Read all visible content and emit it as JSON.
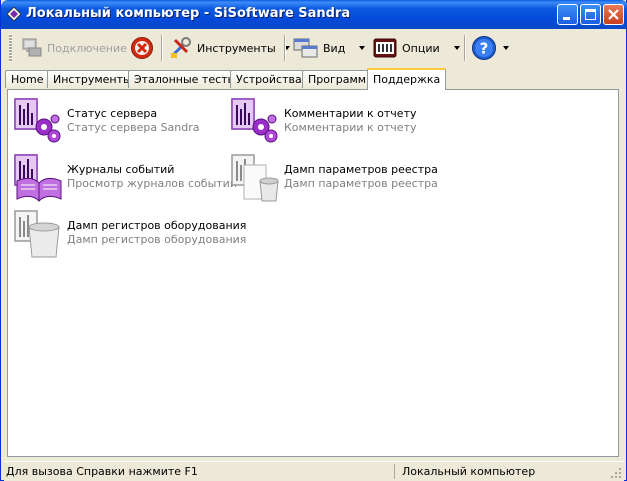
{
  "window": {
    "title": "Локальный компьютер - SiSoftware Sandra"
  },
  "toolbar": {
    "connect_label": "Подключение",
    "tools_label": "Инструменты",
    "view_label": "Вид",
    "options_label": "Опции"
  },
  "tabs": [
    {
      "label": "Home"
    },
    {
      "label": "Инструменты"
    },
    {
      "label": "Эталонные тесты"
    },
    {
      "label": "Устройства"
    },
    {
      "label": "Программы"
    },
    {
      "label": "Поддержка"
    }
  ],
  "items": [
    {
      "name": "Статус сервера",
      "desc": "Статус сервера Sandra",
      "icon": "server-status-icon"
    },
    {
      "name": "Комментарии к отчету",
      "desc": "Комментарии к отчету",
      "icon": "report-comments-icon"
    },
    {
      "name": "Журналы событий",
      "desc": "Просмотр журналов событий",
      "icon": "event-log-icon"
    },
    {
      "name": "Дамп параметров реестра",
      "desc": "Дамп параметров реестра",
      "icon": "registry-dump-icon"
    },
    {
      "name": "Дамп регистров оборудования",
      "desc": "Дамп регистров оборудования",
      "icon": "hardware-dump-icon"
    }
  ],
  "statusbar": {
    "help_text": "Для вызова Справки нажмите F1",
    "location_text": "Локальный компьютер"
  },
  "colors": {
    "titlebar": "#0449d8",
    "active_tab_highlight": "#ffc83c",
    "icon_purple": "#9b30c8",
    "description_gray": "#808080"
  }
}
